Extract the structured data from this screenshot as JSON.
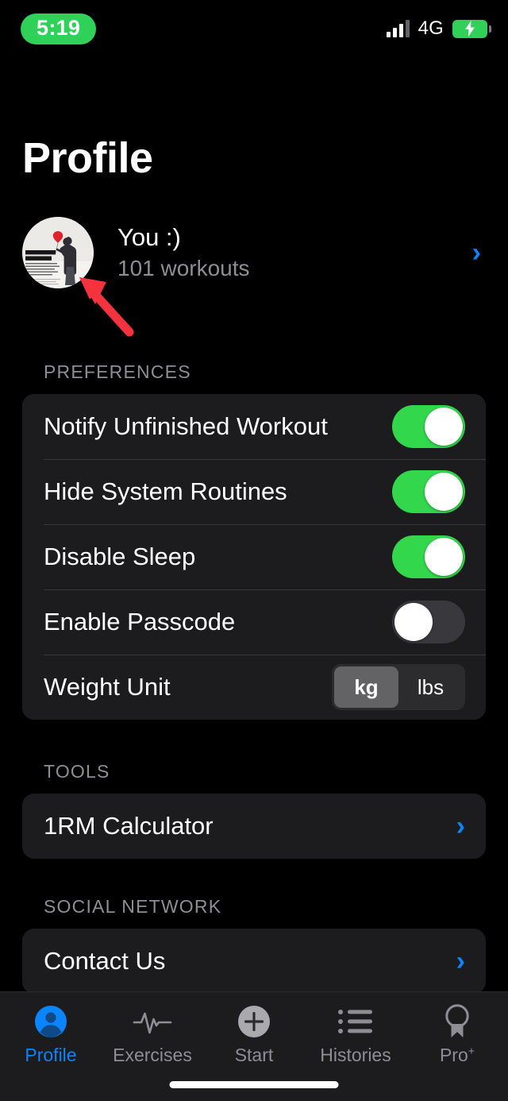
{
  "status_bar": {
    "time": "5:19",
    "network": "4G",
    "signal_icon": "signal-bars-icon",
    "battery_icon": "battery-charging-icon"
  },
  "header": {
    "title": "Profile"
  },
  "profile": {
    "name": "You :)",
    "workouts": "101 workouts",
    "avatar_icon": "avatar-image",
    "chevron": "›"
  },
  "annotation": {
    "arrow_icon": "red-arrow-pointer",
    "color": "#f5333f"
  },
  "sections": [
    {
      "header": "PREFERENCES",
      "rows": [
        {
          "label": "Notify Unfinished Workout",
          "control": "toggle",
          "value": "on"
        },
        {
          "label": "Hide System Routines",
          "control": "toggle",
          "value": "on"
        },
        {
          "label": "Disable Sleep",
          "control": "toggle",
          "value": "on"
        },
        {
          "label": "Enable Passcode",
          "control": "toggle",
          "value": "off"
        },
        {
          "label": "Weight Unit",
          "control": "segmented",
          "options": [
            "kg",
            "lbs"
          ],
          "selected": "kg"
        }
      ]
    },
    {
      "header": "TOOLS",
      "rows": [
        {
          "label": "1RM Calculator",
          "control": "chevron",
          "chevron": "›"
        }
      ]
    },
    {
      "header": "SOCIAL NETWORK",
      "rows": [
        {
          "label": "Contact Us",
          "control": "chevron",
          "chevron": "›"
        }
      ]
    }
  ],
  "tabs": [
    {
      "label": "Profile",
      "icon": "person-circle-icon",
      "active": true
    },
    {
      "label": "Exercises",
      "icon": "pulse-waveform-icon",
      "active": false
    },
    {
      "label": "Start",
      "icon": "plus-circle-icon",
      "active": false
    },
    {
      "label": "Histories",
      "icon": "bulleted-list-icon",
      "active": false
    },
    {
      "label": "Pro",
      "label_sup": "+",
      "icon": "award-medal-icon",
      "active": false
    }
  ],
  "colors": {
    "accent_blue": "#0a84ff",
    "toggle_on_green": "#32d74b",
    "status_pill_green": "#30d158",
    "card_bg": "#1c1c1e",
    "secondary_text": "#8e8e93"
  }
}
